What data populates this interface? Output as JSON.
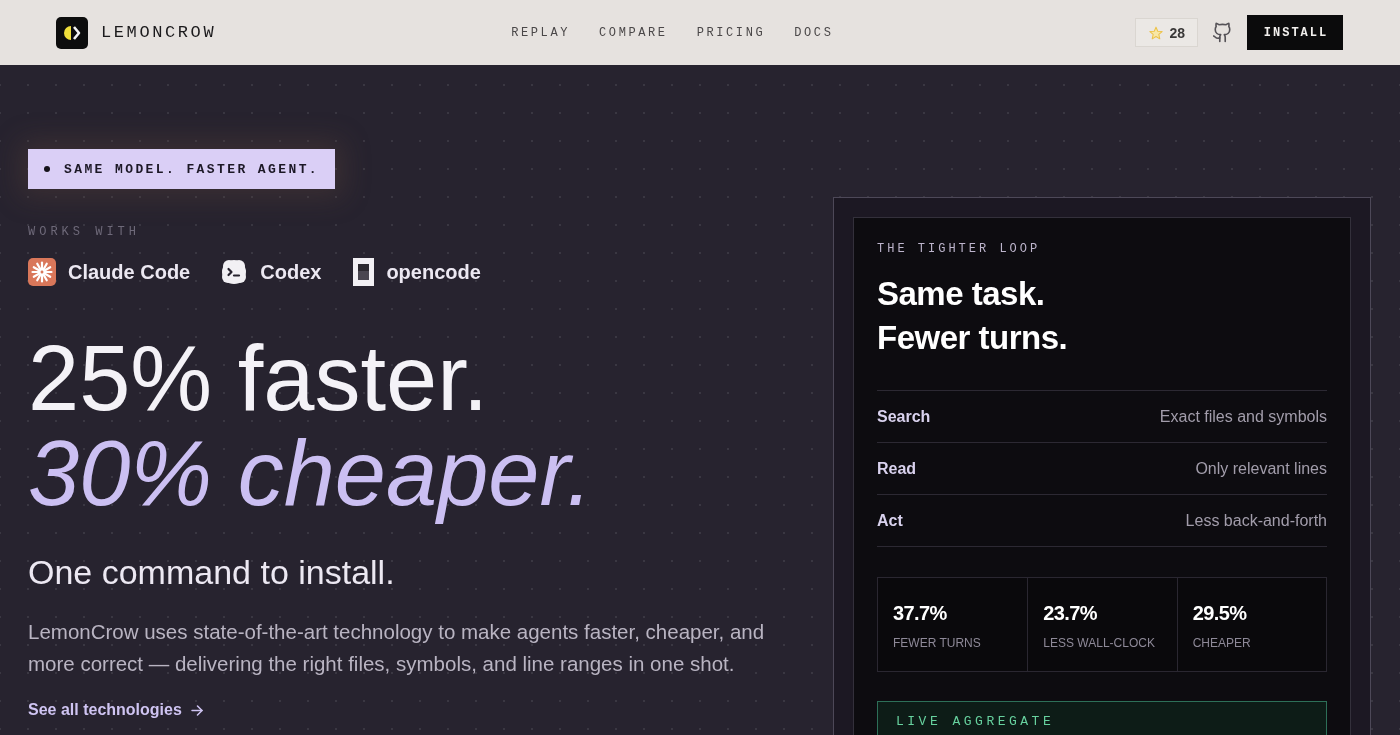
{
  "header": {
    "brand": "LEMONCROW",
    "nav": [
      "REPLAY",
      "COMPARE",
      "PRICING",
      "DOCS"
    ],
    "stars": "28",
    "install": "INSTALL"
  },
  "hero": {
    "tagline": "SAME MODEL. FASTER AGENT.",
    "works_with": "WORKS WITH",
    "agents": [
      {
        "name": "Claude Code",
        "kind": "claude"
      },
      {
        "name": "Codex",
        "kind": "codex"
      },
      {
        "name": "opencode",
        "kind": "opencode"
      }
    ],
    "headline": "25% faster.",
    "headline_accent": "30% cheaper.",
    "subheading": "One command to install.",
    "description": "LemonCrow uses state-of-the-art technology to make agents faster, cheaper, and more correct — delivering the right files, symbols, and line ranges in one shot.",
    "link": "See all technologies"
  },
  "card": {
    "eyebrow": "THE TIGHTER LOOP",
    "title": [
      "Same task.",
      "Fewer turns."
    ],
    "steps": [
      {
        "label": "Search",
        "detail": "Exact files and symbols"
      },
      {
        "label": "Read",
        "detail": "Only relevant lines"
      },
      {
        "label": "Act",
        "detail": "Less back-and-forth"
      }
    ],
    "stats": [
      {
        "value": "37.7%",
        "label": "FEWER TURNS"
      },
      {
        "value": "23.7%",
        "label": "LESS WALL-CLOCK"
      },
      {
        "value": "29.5%",
        "label": "CHEAPER"
      }
    ],
    "live_label": "LIVE AGGREGATE"
  }
}
